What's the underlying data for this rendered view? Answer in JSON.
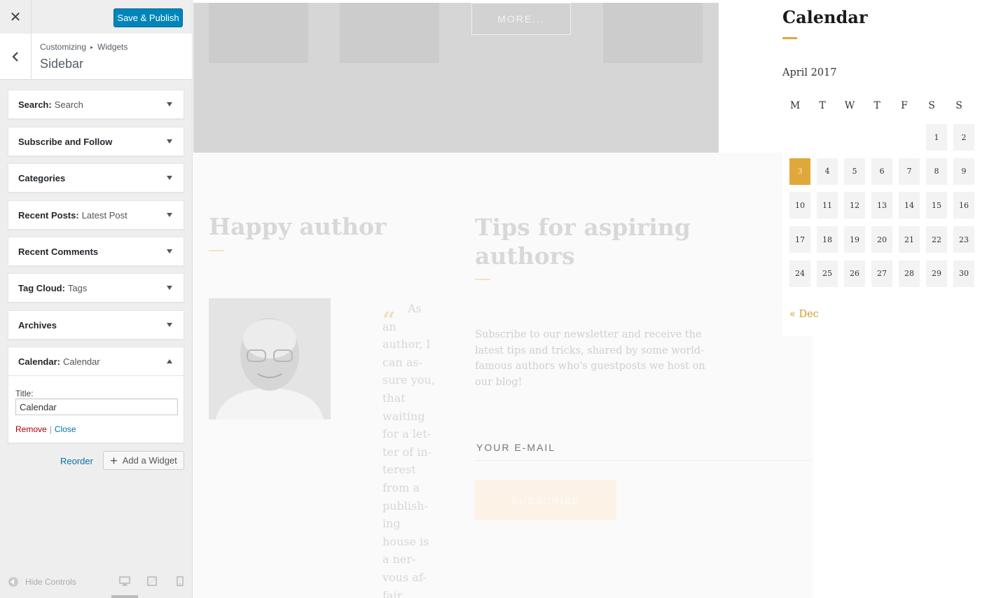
{
  "topbar": {
    "close_glyph": "✕",
    "publish_label": "Save & Publish"
  },
  "section": {
    "breadcrumb_root": "Customizing",
    "breadcrumb_sep": "▸",
    "breadcrumb_leaf": "Widgets",
    "title": "Sidebar"
  },
  "widgets": [
    {
      "name": "Search:",
      "sub": "Search"
    },
    {
      "name": "Subscribe and Follow",
      "sub": ""
    },
    {
      "name": "Categories",
      "sub": ""
    },
    {
      "name": "Recent Posts:",
      "sub": "Latest Post"
    },
    {
      "name": "Recent Comments",
      "sub": ""
    },
    {
      "name": "Tag Cloud:",
      "sub": "Tags"
    },
    {
      "name": "Archives",
      "sub": ""
    },
    {
      "name": "Calendar:",
      "sub": "Calendar"
    }
  ],
  "calendar_form": {
    "title_label": "Title:",
    "title_value": "Calendar",
    "remove_label": "Remove",
    "separator": "|",
    "close_label": "Close"
  },
  "actions": {
    "reorder_label": "Reorder",
    "add_widget_label": "Add a Widget",
    "add_icon": "+"
  },
  "footer": {
    "hide_controls_label": "Hide Controls"
  },
  "preview": {
    "more_label": "MORE...",
    "happy_title": "Happy author",
    "quote_mark": "“",
    "quote_text": "As\nan\nauthor, I\ncan as-\nsure you,\nthat\n waiting\nfor a let-\nter of in-\nterest\nfrom a\npublish-\ning\nhouse is\na ner-\nvous af-\nfair",
    "tips_title": "Tips for aspiring authors",
    "tips_text": "Subscribe to our newsletter and receive the latest tips and tricks, shared by some world-famous authors who's guestposts we host on our blog!",
    "email_placeholder": "YOUR E-MAIL",
    "subscribe_label": "SUBSCRIBE"
  },
  "calendar": {
    "title": "Calendar",
    "month": "April 2017",
    "weekdays": [
      "M",
      "T",
      "W",
      "T",
      "F",
      "S",
      "S"
    ],
    "first_weekday_index": 5,
    "days_in_month": 30,
    "today": 3,
    "prev_link": "« Dec"
  },
  "colors": {
    "accent": "#e0a83a",
    "primary_button": "#0085ba",
    "link": "#0073aa",
    "remove": "#aa0000"
  }
}
